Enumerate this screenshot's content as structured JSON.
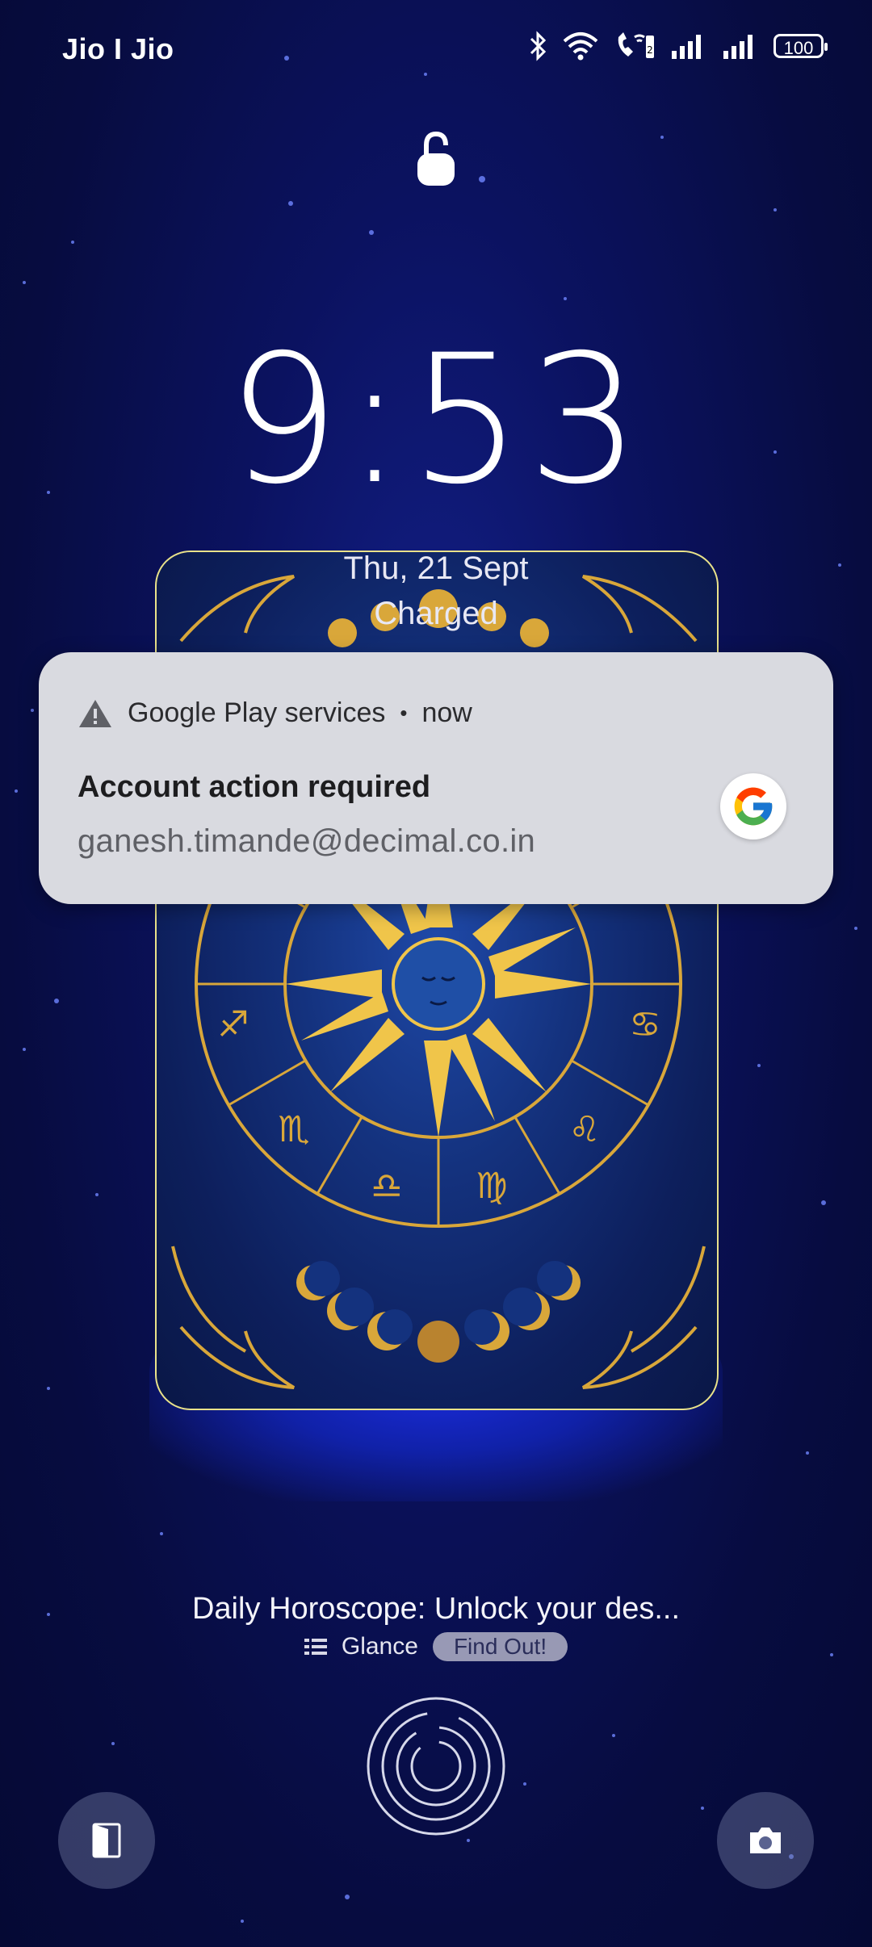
{
  "status_bar": {
    "carrier": "Jio I Jio",
    "battery": "100"
  },
  "lockscreen": {
    "time": "9:53",
    "date": "Thu, 21 Sept",
    "charge_status": "Charged"
  },
  "notification": {
    "app_name": "Google Play services",
    "separator": "•",
    "timestamp": "now",
    "title": "Account action required",
    "subtitle": "ganesh.timande@decimal.co.in",
    "icon": "warning-icon",
    "avatar": "google-logo"
  },
  "glance": {
    "headline": "Daily Horoscope: Unlock your des...",
    "brand": "Glance",
    "cta": "Find Out!"
  },
  "shortcuts": {
    "left": "wallpaper-icon",
    "right": "camera-icon"
  },
  "colors": {
    "background": "#070c40",
    "card_border": "#e9e28a",
    "gold": "#d9a73a",
    "notification_bg": "#d9dae0"
  }
}
